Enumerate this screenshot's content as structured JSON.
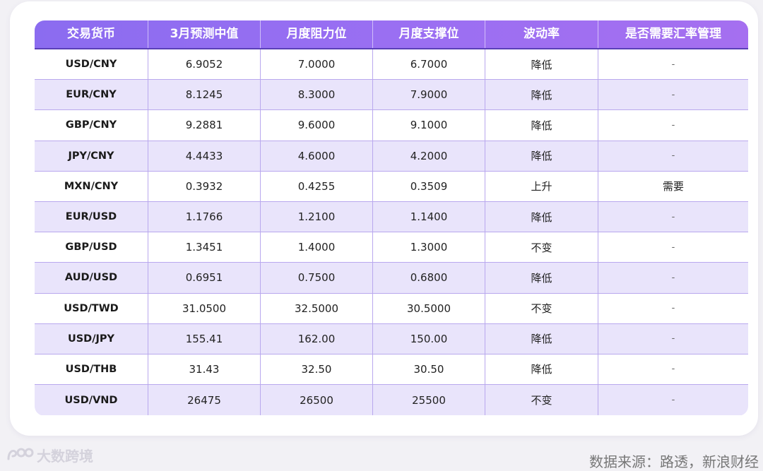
{
  "table": {
    "headers": [
      "交易货币",
      "3月预测中值",
      "月度阻力位",
      "月度支撑位",
      "波动率",
      "是否需要汇率管理"
    ],
    "rows": [
      [
        "USD/CNY",
        "6.9052",
        "7.0000",
        "6.7000",
        "降低",
        "-"
      ],
      [
        "EUR/CNY",
        "8.1245",
        "8.3000",
        "7.9000",
        "降低",
        "-"
      ],
      [
        "GBP/CNY",
        "9.2881",
        "9.6000",
        "9.1000",
        "降低",
        "-"
      ],
      [
        "JPY/CNY",
        "4.4433",
        "4.6000",
        "4.2000",
        "降低",
        "-"
      ],
      [
        "MXN/CNY",
        "0.3932",
        "0.4255",
        "0.3509",
        "上升",
        "需要"
      ],
      [
        "EUR/USD",
        "1.1766",
        "1.2100",
        "1.1400",
        "降低",
        "-"
      ],
      [
        "GBP/USD",
        "1.3451",
        "1.4000",
        "1.3000",
        "不变",
        "-"
      ],
      [
        "AUD/USD",
        "0.6951",
        "0.7500",
        "0.6800",
        "降低",
        "-"
      ],
      [
        "USD/TWD",
        "31.0500",
        "32.5000",
        "30.5000",
        "不变",
        "-"
      ],
      [
        "USD/JPY",
        "155.41",
        "162.00",
        "150.00",
        "降低",
        "-"
      ],
      [
        "USD/THB",
        "31.43",
        "32.50",
        "30.50",
        "降低",
        "-"
      ],
      [
        "USD/VND",
        "26475",
        "26500",
        "25500",
        "不变",
        "-"
      ]
    ]
  },
  "chart_data": {
    "type": "table",
    "columns": [
      "交易货币",
      "3月预测中值",
      "月度阻力位",
      "月度支撑位",
      "波动率",
      "是否需要汇率管理"
    ],
    "rows": [
      {
        "pair": "USD/CNY",
        "forecast_median": 6.9052,
        "resistance": 7.0,
        "support": 6.7,
        "volatility": "降低",
        "fx_management": "-"
      },
      {
        "pair": "EUR/CNY",
        "forecast_median": 8.1245,
        "resistance": 8.3,
        "support": 7.9,
        "volatility": "降低",
        "fx_management": "-"
      },
      {
        "pair": "GBP/CNY",
        "forecast_median": 9.2881,
        "resistance": 9.6,
        "support": 9.1,
        "volatility": "降低",
        "fx_management": "-"
      },
      {
        "pair": "JPY/CNY",
        "forecast_median": 4.4433,
        "resistance": 4.6,
        "support": 4.2,
        "volatility": "降低",
        "fx_management": "-"
      },
      {
        "pair": "MXN/CNY",
        "forecast_median": 0.3932,
        "resistance": 0.4255,
        "support": 0.3509,
        "volatility": "上升",
        "fx_management": "需要"
      },
      {
        "pair": "EUR/USD",
        "forecast_median": 1.1766,
        "resistance": 1.21,
        "support": 1.14,
        "volatility": "降低",
        "fx_management": "-"
      },
      {
        "pair": "GBP/USD",
        "forecast_median": 1.3451,
        "resistance": 1.4,
        "support": 1.3,
        "volatility": "不变",
        "fx_management": "-"
      },
      {
        "pair": "AUD/USD",
        "forecast_median": 0.6951,
        "resistance": 0.75,
        "support": 0.68,
        "volatility": "降低",
        "fx_management": "-"
      },
      {
        "pair": "USD/TWD",
        "forecast_median": 31.05,
        "resistance": 32.5,
        "support": 30.5,
        "volatility": "不变",
        "fx_management": "-"
      },
      {
        "pair": "USD/JPY",
        "forecast_median": 155.41,
        "resistance": 162.0,
        "support": 150.0,
        "volatility": "降低",
        "fx_management": "-"
      },
      {
        "pair": "USD/THB",
        "forecast_median": 31.43,
        "resistance": 32.5,
        "support": 30.5,
        "volatility": "降低",
        "fx_management": "-"
      },
      {
        "pair": "USD/VND",
        "forecast_median": 26475,
        "resistance": 26500,
        "support": 25500,
        "volatility": "不变",
        "fx_management": "-"
      }
    ]
  },
  "footer": {
    "brand": "大数跨境",
    "source": "数据来源：路透，新浪财经"
  },
  "colors": {
    "header_bg": "#9a6ff2",
    "alt_row_bg": "#e9e4fb",
    "grid_line": "#b9a8ee"
  }
}
